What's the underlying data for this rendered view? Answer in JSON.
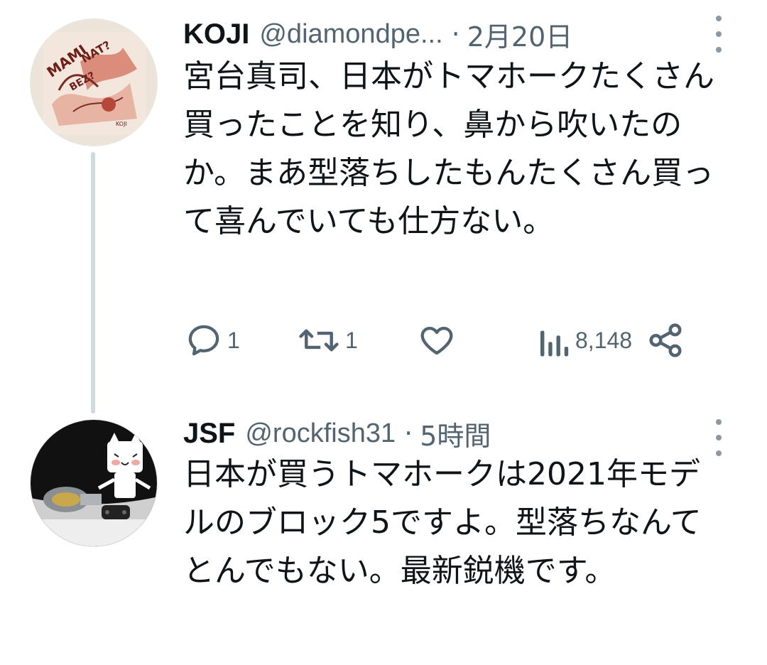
{
  "tweets": [
    {
      "name": "KOJI",
      "handle": "@diamondpe...",
      "separator": "·",
      "time": "2月20日",
      "text": "宮台真司、日本がトマホークたくさん買ったことを知り、鼻から吹いたのか。まあ型落ちしたもんたくさん買って喜んでいても仕方ない。",
      "actions": {
        "reply_count": "1",
        "retweet_count": "1",
        "like_count": "",
        "view_count": "8,148"
      },
      "avatar": {
        "description_icon": "manga-artwork-avatar"
      }
    },
    {
      "name": "JSF",
      "handle": "@rockfish31",
      "separator": "·",
      "time": "5時間",
      "text": "日本が買うトマホークは2021年モデルのブロック5ですよ。型落ちなんてとんでもない。最新鋭機です。",
      "avatar": {
        "description_icon": "white-cat-figure-avatar"
      }
    }
  ],
  "colors": {
    "text_primary": "#0f1419",
    "text_secondary": "#536471",
    "thread_line": "#cfd9de",
    "background": "#ffffff"
  }
}
